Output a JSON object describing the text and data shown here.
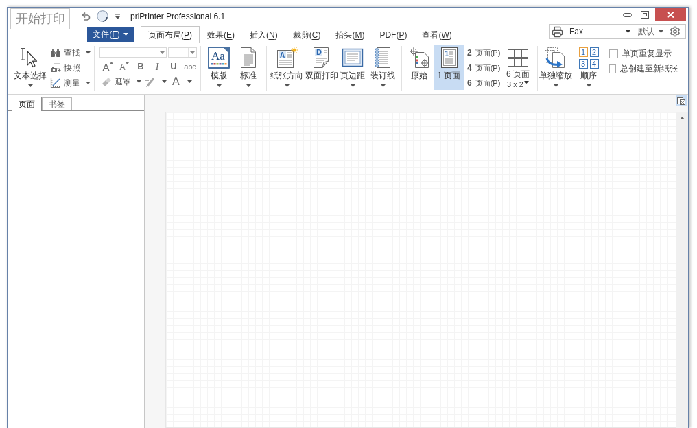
{
  "title_bar": {
    "print_button": "开始打印",
    "title": "priPrinter Professional 6.1"
  },
  "menu": {
    "file_button": "文件(F)",
    "tabs": [
      {
        "label": "页面布局(P)",
        "selected": true
      },
      {
        "label": "效果(E)",
        "selected": false
      },
      {
        "label": "插入(N)",
        "selected": false
      },
      {
        "label": "裁剪(C)",
        "selected": false
      },
      {
        "label": "抬头(M)",
        "selected": false
      },
      {
        "label": "PDF(P)",
        "selected": false
      },
      {
        "label": "查看(W)",
        "selected": false
      }
    ]
  },
  "printer_bar": {
    "printer": "Fax",
    "profile": "默认"
  },
  "ribbon": {
    "select_group": {
      "text_select": {
        "label": "文本选择",
        "dropdown": true
      },
      "tools": [
        {
          "label": "查找",
          "kind": "find",
          "dropdown": true
        },
        {
          "label": "快照",
          "kind": "snapshot",
          "dropdown": false
        },
        {
          "label": "测量",
          "kind": "measure",
          "dropdown": true
        }
      ]
    },
    "font_group": {
      "format_buttons": [
        {
          "glyph": "A",
          "kind": "grow"
        },
        {
          "glyph": "A",
          "kind": "shrink"
        },
        {
          "glyph": "B",
          "kind": "bold"
        },
        {
          "glyph": "I",
          "kind": "italic"
        },
        {
          "glyph": "U",
          "kind": "underline"
        },
        {
          "glyph": "abc",
          "kind": "strike"
        }
      ],
      "tools": [
        {
          "kind": "mask",
          "label": "遮罩"
        },
        {
          "kind": "highlight"
        },
        {
          "kind": "font_color",
          "glyph": "A"
        }
      ]
    },
    "style_group": [
      {
        "label": "模版",
        "kind": "template",
        "glyph": "Aa",
        "dropdown": true
      },
      {
        "label": "标准",
        "kind": "standard",
        "dropdown": true
      }
    ],
    "paper_group": [
      {
        "label": "纸张方向",
        "kind": "orientation",
        "glyph": "A",
        "dropdown": true
      },
      {
        "label": "双面打印",
        "kind": "duplex",
        "glyph": "D",
        "dropdown": false
      },
      {
        "label": "页边距",
        "kind": "margins",
        "dropdown": true
      },
      {
        "label": "装订线",
        "kind": "gutter",
        "dropdown": true
      }
    ],
    "layout_group": {
      "large": [
        {
          "label": "原始",
          "kind": "original",
          "selected": false
        },
        {
          "label": "1 页面",
          "kind": "one_page",
          "glyph": "1",
          "selected": true
        }
      ],
      "pages": [
        {
          "count": "2",
          "label": "页面(P)",
          "selected": false
        },
        {
          "count": "4",
          "label": "页面(P)",
          "selected": false
        },
        {
          "count": "6",
          "label": "页面(P)",
          "selected": false
        }
      ],
      "grid": {
        "label": "6 页面",
        "sub": "3 x 2",
        "selected": false
      }
    },
    "order_group": {
      "scale": {
        "label": "单独缩放",
        "dropdown": true
      },
      "order": {
        "label": "顺序",
        "dropdown": true,
        "tiles": [
          {
            "digit": "1",
            "color": "#e8a040"
          },
          {
            "digit": "2",
            "color": "#3f78b8"
          },
          {
            "digit": "3",
            "color": "#3f78b8"
          },
          {
            "digit": "4",
            "color": "#3f78b8"
          }
        ]
      }
    },
    "options": [
      {
        "label": "单页重复显示",
        "checked": false
      },
      {
        "label": "总创建至新纸张",
        "checked": false
      }
    ]
  },
  "side_panel": {
    "tabs": [
      {
        "label": "页面",
        "selected": true
      },
      {
        "label": "书签",
        "selected": false
      }
    ]
  }
}
